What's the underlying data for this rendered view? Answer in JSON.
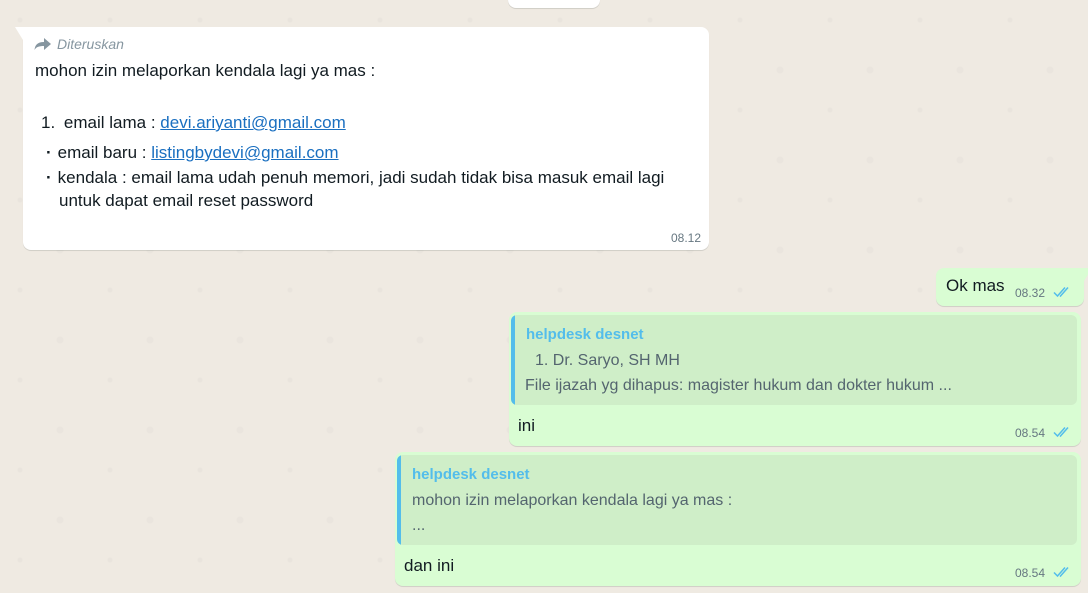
{
  "messages": [
    {
      "type": "incoming",
      "forwarded_label": "Diteruskan",
      "intro": "mohon izin melaporkan kendala lagi ya mas :",
      "list": {
        "item1_num": "1.",
        "item1_label": "email lama : ",
        "item1_link": "devi.ariyanti@gmail.com",
        "item2_label": "email baru : ",
        "item2_link": "listingbydevi@gmail.com",
        "item3_line1": "kendala : email lama udah penuh memori, jadi sudah tidak bisa masuk email lagi",
        "item3_line2": "untuk dapat email reset password"
      },
      "time": "08.12"
    },
    {
      "type": "outgoing",
      "text": "Ok mas",
      "time": "08.32",
      "status_icon": "double-check-icon"
    },
    {
      "type": "outgoing",
      "quote": {
        "author": "helpdesk desnet",
        "line1": "1.  Dr. Saryo, SH MH",
        "line2": "File ijazah yg dihapus: magister hukum dan dokter hukum ..."
      },
      "text": "ini",
      "time": "08.54",
      "status_icon": "double-check-icon"
    },
    {
      "type": "outgoing",
      "quote": {
        "author": "helpdesk desnet",
        "line1": "mohon izin melaporkan kendala lagi ya mas :",
        "line2": "..."
      },
      "text": "dan ini",
      "time": "08.54",
      "status_icon": "double-check-icon"
    }
  ],
  "colors": {
    "incoming_bubble": "#ffffff",
    "outgoing_bubble": "#d9fdd3",
    "quote_accent": "#53bdeb",
    "link": "#1a6fc0",
    "read_ticks": "#53bdeb"
  }
}
